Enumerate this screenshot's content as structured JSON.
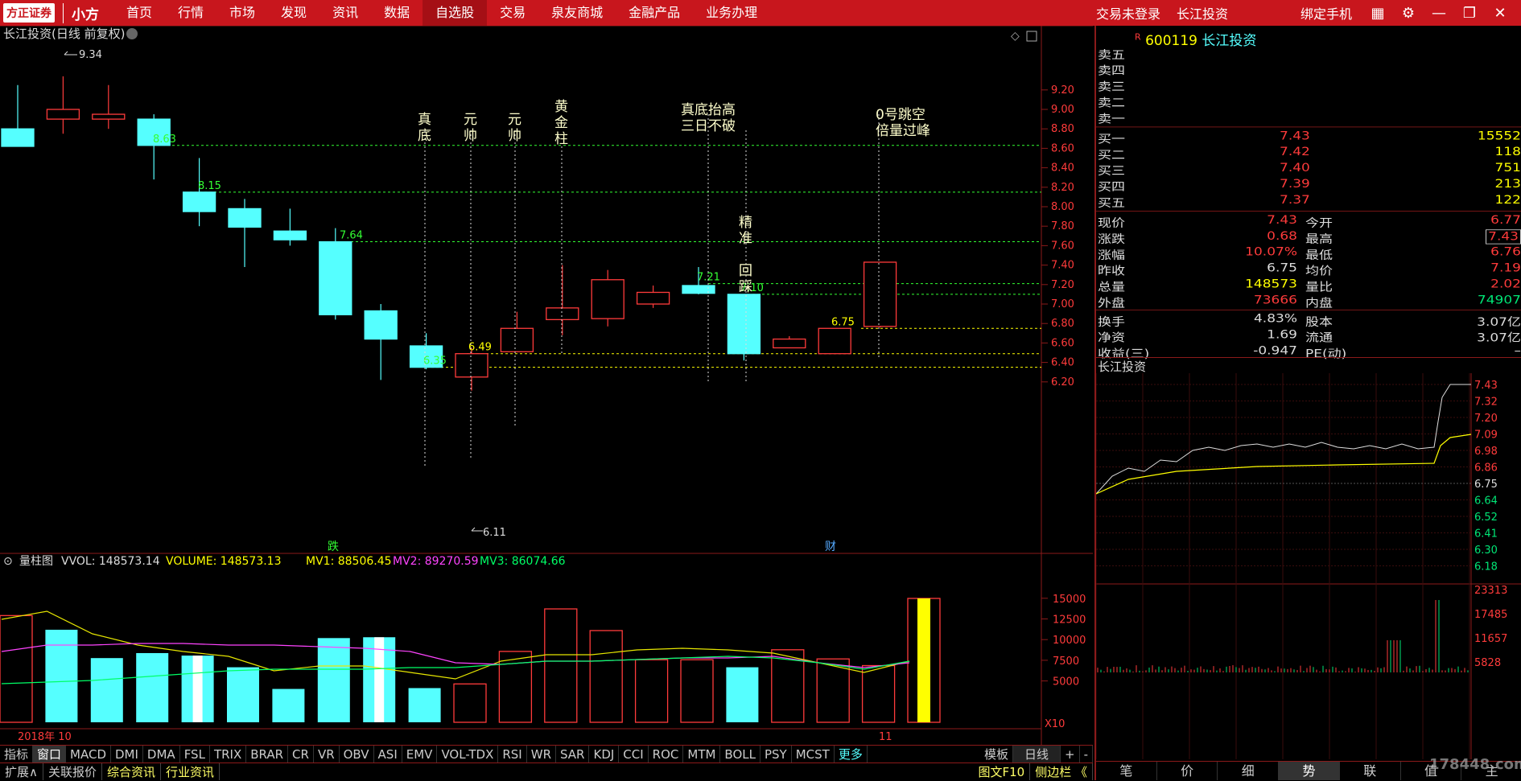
{
  "topbar": {
    "logo": "方正证券",
    "logo_sub": "小方",
    "nav": [
      "首页",
      "行情",
      "市场",
      "发现",
      "资讯",
      "数据",
      "自选股",
      "交易",
      "泉友商城",
      "金融产品",
      "业务办理"
    ],
    "active_nav": "自选股",
    "status": "交易未登录",
    "stock_name": "长江投资",
    "bind_phone": "绑定手机"
  },
  "chart": {
    "header": "长江投资(日线 前复权)",
    "ylabels": [
      "9.20",
      "9.00",
      "8.80",
      "8.60",
      "8.40",
      "8.20",
      "8.00",
      "7.80",
      "7.60",
      "7.40",
      "7.20",
      "7.00",
      "6.80",
      "6.60",
      "6.40",
      "6.20"
    ],
    "high_label": "9.34",
    "low_label": "6.11",
    "price_labels": [
      {
        "t": "8.63"
      },
      {
        "t": "8.15"
      },
      {
        "t": "7.64"
      },
      {
        "t": "6.35"
      },
      {
        "t": "6.49"
      },
      {
        "t": "7.21"
      },
      {
        "t": "7.10"
      },
      {
        "t": "6.75"
      }
    ],
    "annotations": [
      "真底",
      "元帅",
      "元帅",
      "黄金柱",
      "真底抬高三日不破",
      "精准 回踩",
      "0号跳空倍量过峰"
    ],
    "markers": [
      "跌",
      "财"
    ],
    "candles": [
      {
        "o": 8.8,
        "c": 8.62,
        "h": 9.25,
        "l": 8.62
      },
      {
        "o": 8.9,
        "c": 9.0,
        "h": 9.34,
        "l": 8.75
      },
      {
        "o": 8.9,
        "c": 8.95,
        "h": 9.25,
        "l": 8.8
      },
      {
        "o": 8.9,
        "c": 8.63,
        "h": 8.95,
        "l": 8.28
      },
      {
        "o": 8.15,
        "c": 7.95,
        "h": 8.5,
        "l": 7.8
      },
      {
        "o": 7.98,
        "c": 7.79,
        "h": 8.08,
        "l": 7.38
      },
      {
        "o": 7.75,
        "c": 7.66,
        "h": 7.98,
        "l": 7.6
      },
      {
        "o": 7.64,
        "c": 6.89,
        "h": 7.78,
        "l": 6.84
      },
      {
        "o": 6.93,
        "c": 6.64,
        "h": 7.0,
        "l": 6.22
      },
      {
        "o": 6.57,
        "c": 6.35,
        "h": 6.7,
        "l": 6.33
      },
      {
        "o": 6.25,
        "c": 6.49,
        "h": 6.55,
        "l": 6.11
      },
      {
        "o": 6.51,
        "c": 6.75,
        "h": 6.92,
        "l": 6.51
      },
      {
        "o": 6.84,
        "c": 6.96,
        "h": 7.4,
        "l": 6.68
      },
      {
        "o": 6.85,
        "c": 7.25,
        "h": 7.35,
        "l": 6.77
      },
      {
        "o": 7.0,
        "c": 7.12,
        "h": 7.19,
        "l": 6.96
      },
      {
        "o": 7.19,
        "c": 7.11,
        "h": 7.38,
        "l": 7.1
      },
      {
        "o": 7.1,
        "c": 6.49,
        "h": 7.1,
        "l": 6.42
      },
      {
        "o": 6.55,
        "c": 6.64,
        "h": 6.67,
        "l": 6.55
      },
      {
        "o": 6.49,
        "c": 6.75,
        "h": 6.75,
        "l": 6.49
      },
      {
        "o": 6.77,
        "c": 7.43,
        "h": 7.43,
        "l": 6.76
      }
    ],
    "date_start": "2018年 10",
    "date_end": "11"
  },
  "volume": {
    "header": "量柱图",
    "vvol": "VVOL: 148573.14",
    "volume": "VOLUME: 148573.13",
    "mv1": "MV1: 88506.45",
    "mv2": "MV2: 89270.59",
    "mv3": "MV3: 86074.66",
    "ylabels": [
      "15000",
      "12500",
      "10000",
      "7500",
      "5000"
    ],
    "x10": "X10",
    "vols": [
      128000,
      111000,
      77000,
      83000,
      80000,
      66000,
      40000,
      101000,
      102000,
      41000,
      46000,
      85000,
      136000,
      110000,
      75000,
      75000,
      66000,
      87000,
      76000,
      68000,
      148573
    ]
  },
  "bottom_tabs": [
    "指标",
    "窗口",
    "MACD",
    "DMI",
    "DMA",
    "FSL",
    "TRIX",
    "BRAR",
    "CR",
    "VR",
    "OBV",
    "ASI",
    "EMV",
    "VOL-TDX",
    "RSI",
    "WR",
    "SAR",
    "KDJ",
    "CCI",
    "ROC",
    "MTM",
    "BOLL",
    "PSY",
    "MCST",
    "更多"
  ],
  "bottom_right": [
    "模板",
    "日线",
    "+",
    "-"
  ],
  "bottom_bar": [
    "扩展∧",
    "关联报价",
    "综合资讯",
    "行业资讯"
  ],
  "bottom_bar_right": [
    "图文F10",
    "侧边栏 《"
  ],
  "quote": {
    "code": "600119",
    "name": "长江投资",
    "r": "R",
    "sell": [
      "卖五",
      "卖四",
      "卖三",
      "卖二",
      "卖一"
    ],
    "buy": [
      {
        "l": "买一",
        "p": "7.43",
        "v": "15552"
      },
      {
        "l": "买二",
        "p": "7.42",
        "v": "118"
      },
      {
        "l": "买三",
        "p": "7.40",
        "v": "751"
      },
      {
        "l": "买四",
        "p": "7.39",
        "v": "213"
      },
      {
        "l": "买五",
        "p": "7.37",
        "v": "122"
      }
    ],
    "stats": [
      [
        "现价",
        "7.43",
        "今开",
        "6.77"
      ],
      [
        "涨跌",
        "0.68",
        "最高",
        "7.43"
      ],
      [
        "涨幅",
        "10.07%",
        "最低",
        "6.76"
      ],
      [
        "昨收",
        "6.75",
        "均价",
        "7.19"
      ],
      [
        "总量",
        "148573",
        "量比",
        "2.02"
      ],
      [
        "外盘",
        "73666",
        "内盘",
        "74907"
      ]
    ],
    "stats2": [
      [
        "换手",
        "4.83%",
        "股本",
        "3.07亿"
      ],
      [
        "净资",
        "1.69",
        "流通",
        "3.07亿"
      ],
      [
        "收益(三)",
        "-0.947",
        "PE(动)",
        "–"
      ]
    ],
    "mini_title": "长江投资",
    "mini_ylabels": [
      "7.43",
      "7.32",
      "7.20",
      "7.09",
      "6.98",
      "6.86",
      "6.75",
      "6.64",
      "6.52",
      "6.41",
      "6.30",
      "6.18"
    ],
    "mini_vlabels": [
      "23313",
      "17485",
      "11657",
      "5828"
    ],
    "tabs": [
      "笔",
      "价",
      "细",
      "势",
      "联",
      "值",
      "主"
    ],
    "active_tab": "势"
  },
  "watermark": "178448.com",
  "colors": {
    "up": "#ff3b3b",
    "down": "#55ffff",
    "accent": "#c8161d"
  }
}
